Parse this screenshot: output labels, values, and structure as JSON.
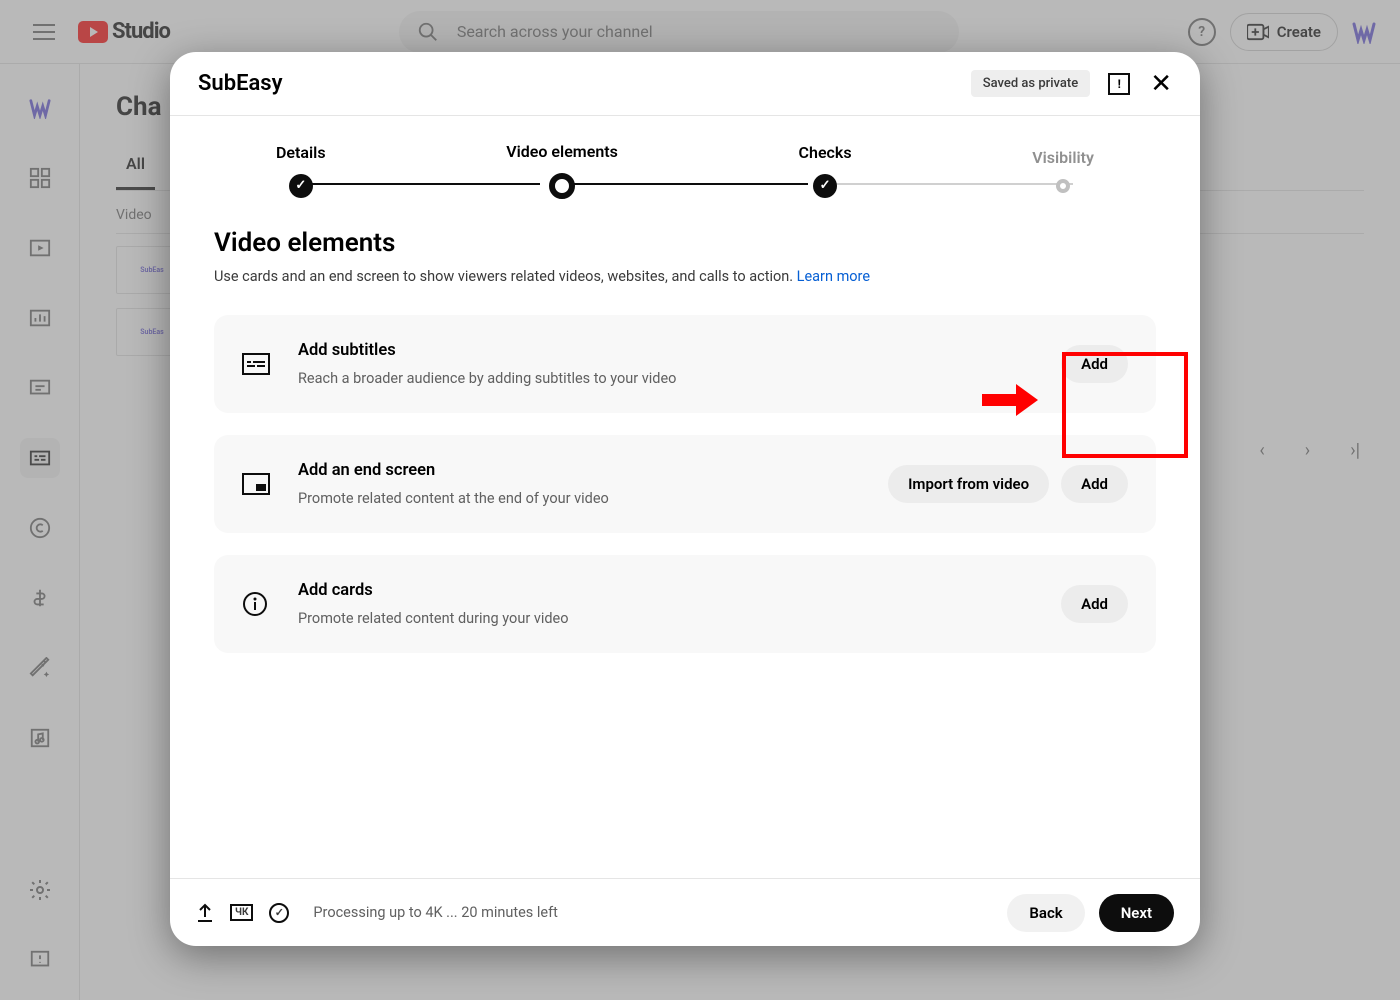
{
  "topbar": {
    "studio_label": "Studio",
    "search_placeholder": "Search across your channel",
    "create_label": "Create",
    "help_symbol": "?"
  },
  "bg": {
    "page_title_partial": "Cha",
    "tab_all": "All",
    "col_video": "Video"
  },
  "modal": {
    "title": "SubEasy",
    "saved_chip": "Saved as private"
  },
  "stepper": {
    "s1": "Details",
    "s2": "Video elements",
    "s3": "Checks",
    "s4": "Visibility"
  },
  "section": {
    "title": "Video elements",
    "desc": "Use cards and an end screen to show viewers related videos, websites, and calls to action. ",
    "learn_more": "Learn more"
  },
  "cards": {
    "subtitles": {
      "title": "Add subtitles",
      "sub": "Reach a broader audience by adding subtitles to your video",
      "btn": "Add"
    },
    "endscreen": {
      "title": "Add an end screen",
      "sub": "Promote related content at the end of your video",
      "btn_import": "Import from video",
      "btn_add": "Add"
    },
    "cardsrow": {
      "title": "Add cards",
      "sub": "Promote related content during your video",
      "btn": "Add"
    }
  },
  "footer": {
    "hk": "ЧК",
    "status": "Processing up to 4K ... 20 minutes left",
    "back": "Back",
    "next": "Next"
  }
}
